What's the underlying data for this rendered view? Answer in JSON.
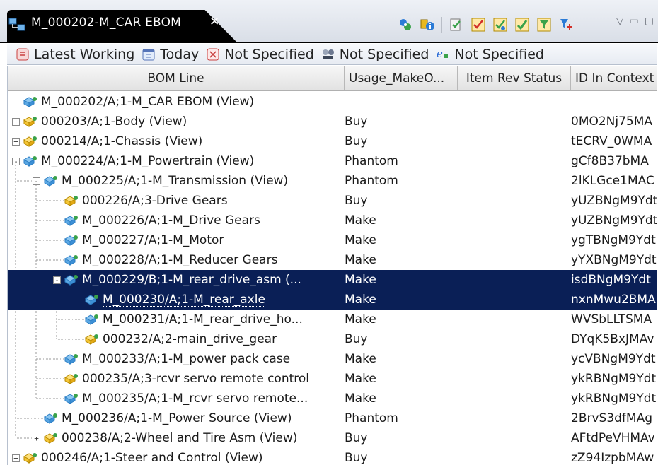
{
  "tab": {
    "title": "M_000202-M_CAR EBOM",
    "close": "✕"
  },
  "toolbar": {
    "buttons": [
      "structure-icon",
      "info-icon",
      "paste-icon",
      "check-icon",
      "approve-icon",
      "accept-icon",
      "filter-icon",
      "tree-filter-icon"
    ],
    "colors": {
      "blue": "#2b7bd6",
      "green": "#3aa24a",
      "red": "#d2302a",
      "yellow": "#e8b820"
    }
  },
  "window_controls": {
    "menu": "▽",
    "minimize": "▭",
    "restore": "▢"
  },
  "revision_rules": [
    {
      "icon": "rule-icon",
      "label": "Latest Working"
    },
    {
      "icon": "date-icon",
      "label": "Today"
    },
    {
      "icon": "unit-icon",
      "label": "Not Specified"
    },
    {
      "icon": "variant-icon",
      "label": "Not Specified"
    },
    {
      "icon": "context-icon",
      "label": "Not Specified"
    }
  ],
  "columns": {
    "bom_line": "BOM Line",
    "usage": "Usage_MakeO...",
    "status": "Item Rev Status",
    "id_context": "ID In Context"
  },
  "rows": [
    {
      "level": 0,
      "expander": "",
      "icon": "assembly",
      "label": "M_000202/A;1-M_CAR EBOM (View)",
      "usage": "",
      "id": ""
    },
    {
      "level": 0,
      "expander": "+",
      "icon": "item",
      "label": "000203/A;1-Body (View)",
      "usage": "Buy",
      "id": "0MO2Nj75MA"
    },
    {
      "level": 0,
      "expander": "+",
      "icon": "item",
      "label": "000214/A;1-Chassis (View)",
      "usage": "Buy",
      "id": "tECRV_0WMA"
    },
    {
      "level": 0,
      "expander": "-",
      "icon": "assembly",
      "label": "M_000224/A;1-M_Powertrain (View)",
      "usage": "Phantom",
      "id": "gCf8B37bMA"
    },
    {
      "level": 1,
      "expander": "-",
      "icon": "assembly",
      "label": "M_000225/A;1-M_Transmission (View)",
      "usage": "Phantom",
      "id": "2lKLGce1MAC"
    },
    {
      "level": 2,
      "expander": "",
      "icon": "item",
      "label": "000226/A;3-Drive Gears",
      "usage": "Buy",
      "id": "yUZBNgM9Ydt"
    },
    {
      "level": 2,
      "expander": "",
      "icon": "assembly",
      "label": "M_000226/A;1-M_Drive Gears",
      "usage": "Make",
      "id": "yUZBNgM9Ydt"
    },
    {
      "level": 2,
      "expander": "",
      "icon": "assembly",
      "label": "M_000227/A;1-M_Motor",
      "usage": "Make",
      "id": "ygTBNgM9Ydt"
    },
    {
      "level": 2,
      "expander": "",
      "icon": "assembly",
      "label": "M_000228/A;1-M_Reducer Gears",
      "usage": "Make",
      "id": "yYXBNgM9Ydt"
    },
    {
      "level": 2,
      "expander": "-",
      "icon": "assembly",
      "label": "M_000229/B;1-M_rear_drive_asm (...",
      "usage": "Make",
      "id": "isdBNgM9Ydt",
      "selected": true
    },
    {
      "level": 3,
      "expander": "",
      "icon": "assembly",
      "label": "M_000230/A;1-M_rear_axle",
      "usage": "Make",
      "id": "nxnMwu2BMA",
      "selected": true,
      "focus": true
    },
    {
      "level": 3,
      "expander": "",
      "icon": "assembly",
      "label": "M_000231/A;1-M_rear_drive_ho...",
      "usage": "Make",
      "id": "WVSbLLTSMA"
    },
    {
      "level": 3,
      "expander": "",
      "icon": "item",
      "label": "000232/A;2-main_drive_gear",
      "usage": "Buy",
      "id": "DYqK5BxJMAv"
    },
    {
      "level": 2,
      "expander": "",
      "icon": "assembly",
      "label": "M_000233/A;1-M_power pack case",
      "usage": "Make",
      "id": "ycVBNgM9Ydt"
    },
    {
      "level": 2,
      "expander": "",
      "icon": "item",
      "label": "000235/A;3-rcvr servo remote control",
      "usage": "Make",
      "id": "ykRBNgM9Ydt"
    },
    {
      "level": 2,
      "expander": "",
      "icon": "assembly",
      "label": "M_000235/A;1-M_rcvr servo remote...",
      "usage": "Make",
      "id": "ykRBNgM9Ydt"
    },
    {
      "level": 1,
      "expander": "",
      "icon": "assembly",
      "label": "M_000236/A;1-M_Power Source (View)",
      "usage": "Phantom",
      "id": "2BrvS3dfMAg"
    },
    {
      "level": 1,
      "expander": "+",
      "icon": "item",
      "label": "000238/A;2-Wheel and Tire Asm (View)",
      "usage": "Buy",
      "id": "AFtdPeVHMAv"
    },
    {
      "level": 0,
      "expander": "+",
      "icon": "item",
      "label": "000246/A;1-Steer and Control (View)",
      "usage": "Buy",
      "id": "zZ94IzpbMAw"
    }
  ],
  "colors": {
    "selection": "#0a1f56",
    "tab_bg": "#000000",
    "header_bg": "#e9e9e9"
  }
}
